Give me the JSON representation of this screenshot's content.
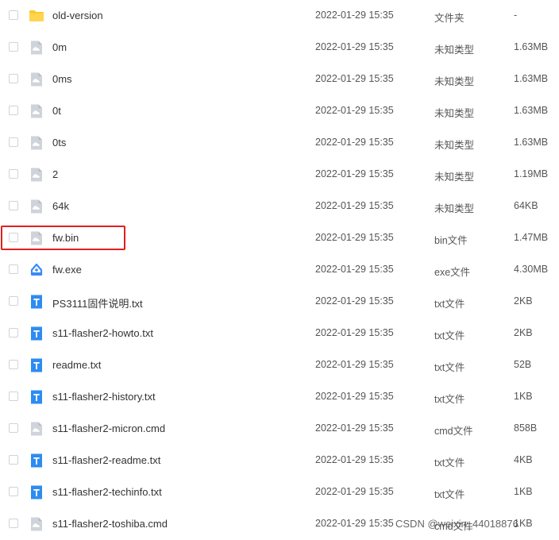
{
  "files": [
    {
      "name": "old-version",
      "date": "2022-01-29 15:35",
      "type": "文件夹",
      "size": "-",
      "icon": "folder-icon"
    },
    {
      "name": "0m",
      "date": "2022-01-29 15:35",
      "type": "未知类型",
      "size": "1.63MB",
      "icon": "cloud-file-icon"
    },
    {
      "name": "0ms",
      "date": "2022-01-29 15:35",
      "type": "未知类型",
      "size": "1.63MB",
      "icon": "cloud-file-icon"
    },
    {
      "name": "0t",
      "date": "2022-01-29 15:35",
      "type": "未知类型",
      "size": "1.63MB",
      "icon": "cloud-file-icon"
    },
    {
      "name": "0ts",
      "date": "2022-01-29 15:35",
      "type": "未知类型",
      "size": "1.63MB",
      "icon": "cloud-file-icon"
    },
    {
      "name": "2",
      "date": "2022-01-29 15:35",
      "type": "未知类型",
      "size": "1.19MB",
      "icon": "cloud-file-icon"
    },
    {
      "name": "64k",
      "date": "2022-01-29 15:35",
      "type": "未知类型",
      "size": "64KB",
      "icon": "cloud-file-icon"
    },
    {
      "name": "fw.bin",
      "date": "2022-01-29 15:35",
      "type": "bin文件",
      "size": "1.47MB",
      "icon": "cloud-file-icon"
    },
    {
      "name": "fw.exe",
      "date": "2022-01-29 15:35",
      "type": "exe文件",
      "size": "4.30MB",
      "icon": "exe-file-icon"
    },
    {
      "name": "PS3111固件说明.txt",
      "date": "2022-01-29 15:35",
      "type": "txt文件",
      "size": "2KB",
      "icon": "text-file-icon"
    },
    {
      "name": "s11-flasher2-howto.txt",
      "date": "2022-01-29 15:35",
      "type": "txt文件",
      "size": "2KB",
      "icon": "text-file-icon"
    },
    {
      "name": "readme.txt",
      "date": "2022-01-29 15:35",
      "type": "txt文件",
      "size": "52B",
      "icon": "text-file-icon"
    },
    {
      "name": "s11-flasher2-history.txt",
      "date": "2022-01-29 15:35",
      "type": "txt文件",
      "size": "1KB",
      "icon": "text-file-icon"
    },
    {
      "name": "s11-flasher2-micron.cmd",
      "date": "2022-01-29 15:35",
      "type": "cmd文件",
      "size": "858B",
      "icon": "cloud-file-icon"
    },
    {
      "name": "s11-flasher2-readme.txt",
      "date": "2022-01-29 15:35",
      "type": "txt文件",
      "size": "4KB",
      "icon": "text-file-icon"
    },
    {
      "name": "s11-flasher2-techinfo.txt",
      "date": "2022-01-29 15:35",
      "type": "txt文件",
      "size": "1KB",
      "icon": "text-file-icon"
    },
    {
      "name": "s11-flasher2-toshiba.cmd",
      "date": "2022-01-29 15:35",
      "type": "cmd文件",
      "size": "1KB",
      "icon": "cloud-file-icon"
    }
  ],
  "highlighted_file": "fw.bin",
  "watermark": "CSDN @weixin_44018876",
  "colors": {
    "folder": "#ffca28",
    "cloud_file": "#cfd3da",
    "exe_file": "#3a8bf5",
    "text_file": "#2d8cf0",
    "highlight_border": "#e02020"
  }
}
